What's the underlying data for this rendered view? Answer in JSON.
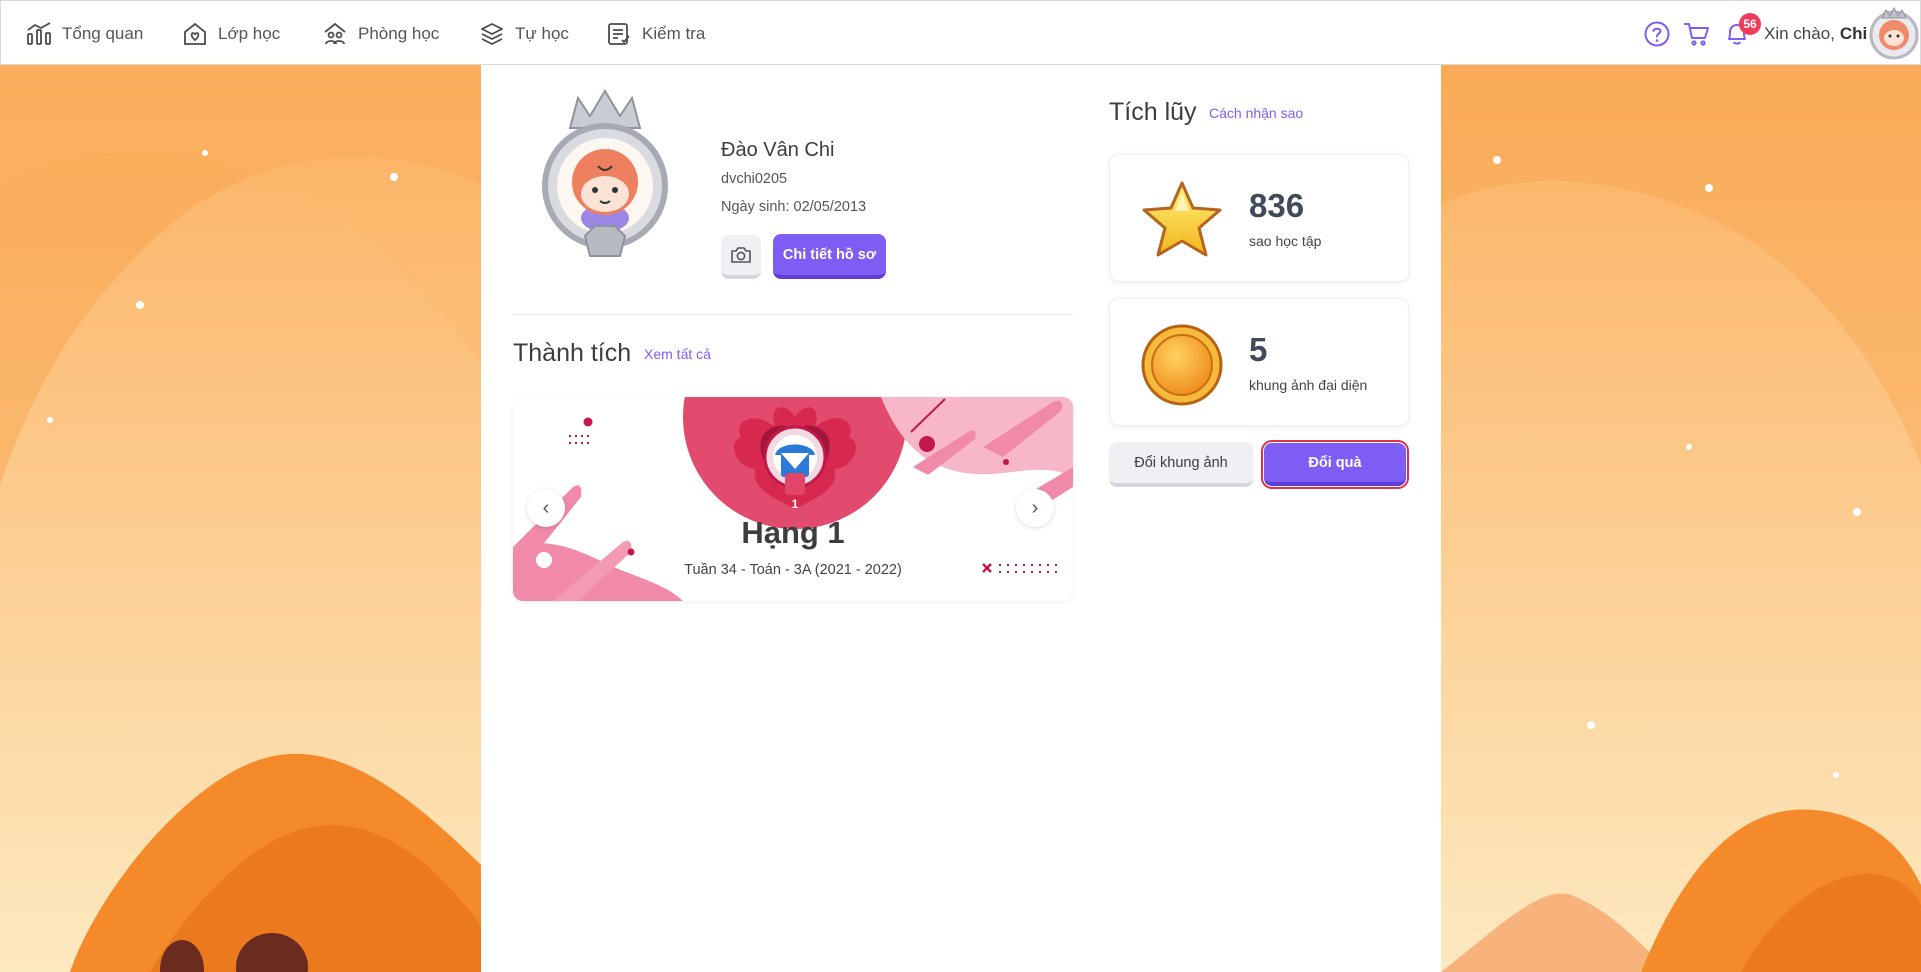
{
  "nav": {
    "items": [
      {
        "label": "Tổng quan",
        "icon": "chart-bars-icon"
      },
      {
        "label": "Lớp học",
        "icon": "house-heart-icon"
      },
      {
        "label": "Phòng học",
        "icon": "group-icon"
      },
      {
        "label": "Tự học",
        "icon": "layers-icon"
      },
      {
        "label": "Kiểm tra",
        "icon": "checklist-icon"
      }
    ],
    "notification_count": "56",
    "greeting_prefix": "Xin chào,",
    "greeting_name": "Chi"
  },
  "profile": {
    "name": "Đào Vân Chi",
    "username": "dvchi0205",
    "birth_label": "Ngày sinh:",
    "birth_date": "02/05/2013",
    "detail_button": "Chi tiết hồ sơ"
  },
  "achievements": {
    "title": "Thành tích",
    "view_all": "Xem tất cả",
    "badge_rank_number": "1",
    "card_title": "Hạng 1",
    "card_subtitle": "Tuần 34 - Toán - 3A (2021 - 2022)"
  },
  "accumulation": {
    "title": "Tích lũy",
    "how_to_link": "Cách nhận sao",
    "stars_value": "836",
    "stars_label": "sao học tập",
    "frames_value": "5",
    "frames_label": "khung ảnh đại diện",
    "exchange_frame_button": "Đổi khung ảnh",
    "exchange_gift_button": "Đổi quà"
  },
  "colors": {
    "accent": "#7e5df5",
    "badge": "#ee3c5a",
    "pink": "#f08aa8",
    "crimson": "#c2184a"
  }
}
